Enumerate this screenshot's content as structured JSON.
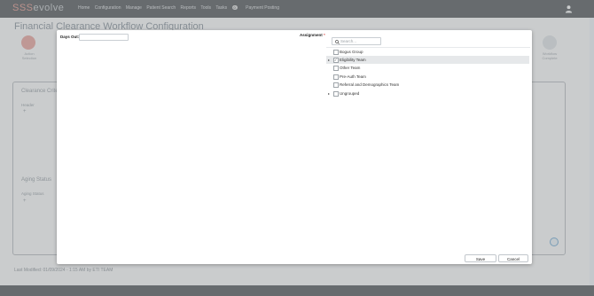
{
  "app": {
    "logo_prefix": "SSS",
    "logo_suffix": "evolve",
    "nav_items": [
      "Home",
      "Configuration",
      "Manage",
      "Patient Search",
      "Reports",
      "Tools",
      "Tasks"
    ],
    "tasks_badge": "0",
    "nav_last": "Payment Posting"
  },
  "page": {
    "title": "Financial Clearance Workflow Configuration",
    "step_left_label": "Action Selection",
    "step_right_label": "Workflow Complete",
    "section1_heading": "Clearance Criteria",
    "section1_label": "Header",
    "section2_heading": "Aging Status",
    "section2_label": "Aging Status",
    "last_modified": "Last Modified: 01/09/2024 - 1:15 AM by ETI TEAM"
  },
  "modal": {
    "days_out_label": "Days Out:",
    "days_out_value": "",
    "assignment_label": "Assignment",
    "required_mark": "*",
    "search_placeholder": "Search...",
    "tree": [
      {
        "label": "Bogus Group",
        "expandable": false,
        "checked": false,
        "selected": false
      },
      {
        "label": "Eligibility Team",
        "expandable": true,
        "checked": true,
        "selected": true
      },
      {
        "label": "Other Team",
        "expandable": false,
        "checked": false,
        "selected": false
      },
      {
        "label": "Pre-Auth Team",
        "expandable": false,
        "checked": false,
        "selected": false
      },
      {
        "label": "Referral and Demographics Team",
        "expandable": false,
        "checked": false,
        "selected": false
      },
      {
        "label": "Ungrouped",
        "expandable": true,
        "checked": false,
        "selected": false
      }
    ],
    "save_label": "Save",
    "cancel_label": "Cancel"
  },
  "colors": {
    "navbar": "#6e7174",
    "accent": "#e9a9a0",
    "selected_row": "#e6e8ea"
  }
}
